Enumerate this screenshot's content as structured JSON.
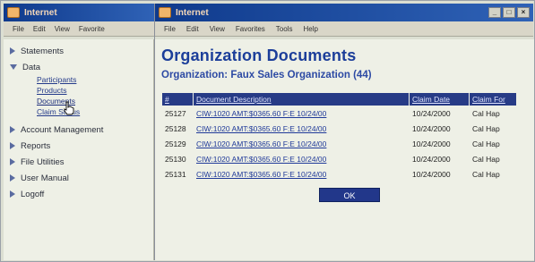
{
  "left_window": {
    "title": "Internet",
    "menu": [
      "File",
      "Edit",
      "View",
      "Favorite"
    ]
  },
  "right_window": {
    "title": "Internet",
    "menu": [
      "File",
      "Edit",
      "View",
      "Favorites",
      "Tools",
      "Help"
    ],
    "controls": [
      "_",
      "□",
      "×"
    ]
  },
  "sidebar": {
    "items": [
      {
        "label": "Statements",
        "expanded": false
      },
      {
        "label": "Data",
        "expanded": true,
        "children": [
          "Participants",
          "Products",
          "Documents",
          "Claim Status"
        ]
      },
      {
        "label": "Account Management",
        "expanded": false
      },
      {
        "label": "Reports",
        "expanded": false
      },
      {
        "label": "File Utilities",
        "expanded": false
      },
      {
        "label": "User Manual",
        "expanded": false
      },
      {
        "label": "Logoff",
        "expanded": false
      }
    ]
  },
  "main": {
    "title": "Organization Documents",
    "org_label": "Organization:",
    "org_name": "Faux Sales Organization (44)",
    "table": {
      "headers": [
        "#",
        "Document Description",
        "Claim Date",
        "Claim For"
      ],
      "rows": [
        [
          "25127",
          "CIW:1020 AMT:$0365.60 F:E 10/24/00",
          "10/24/2000",
          "Cal Hap"
        ],
        [
          "25128",
          "CIW:1020 AMT:$0365.60 F:E 10/24/00",
          "10/24/2000",
          "Cal Hap"
        ],
        [
          "25129",
          "CIW:1020 AMT:$0365.60 F:E 10/24/00",
          "10/24/2000",
          "Cal Hap"
        ],
        [
          "25130",
          "CIW:1020 AMT:$0365.60 F:E 10/24/00",
          "10/24/2000",
          "Cal Hap"
        ],
        [
          "25131",
          "CIW:1020 AMT:$0365.60 F:E 10/24/00",
          "10/24/2000",
          "Cal Hap"
        ]
      ]
    },
    "ok_label": "OK"
  },
  "colors": {
    "title_bar": "#0f3a8c",
    "heading": "#1c3e9a",
    "table_header": "#273b86"
  }
}
